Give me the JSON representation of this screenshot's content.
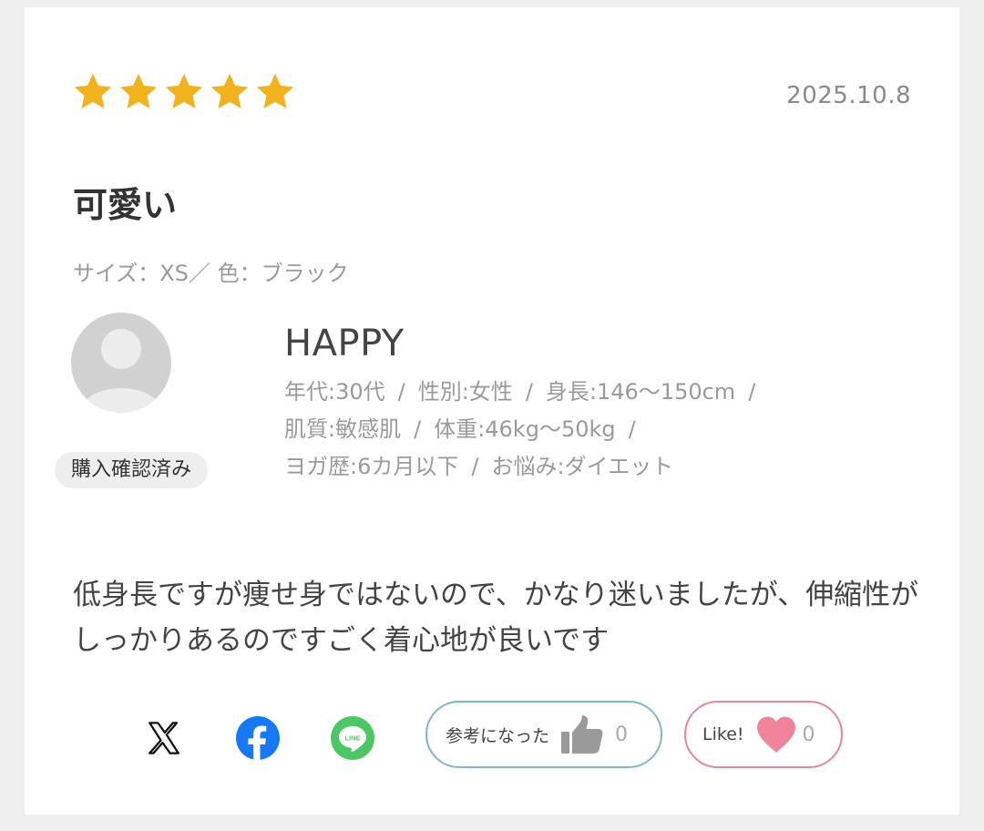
{
  "review": {
    "rating": 5,
    "max_rating": 5,
    "date": "2025.10.8",
    "title": "可愛い",
    "variant": "サイズ：XS／ 色：ブラック",
    "body": "低身長ですが痩せ身ではないので、かなり迷いましたが、伸縮性がしっかりあるのですごく着心地が良いです",
    "star_color": "#f2b21e"
  },
  "reviewer": {
    "name": "HAPPY",
    "badge": "購入確認済み",
    "attributes": [
      "年代:30代",
      "性別:女性",
      "身長:146〜150cm",
      "肌質:敏感肌",
      "体重:46kg〜50kg",
      "ヨガ歴:6カ月以下",
      "お悩み:ダイエット"
    ],
    "separator": "/"
  },
  "share": {
    "icons": [
      "x-icon",
      "facebook-icon",
      "line-icon"
    ],
    "line_label": "LINE",
    "facebook_color": "#1877f2",
    "line_color": "#4cc764"
  },
  "actions": {
    "helpful_label": "参考になった",
    "helpful_count": "0",
    "helpful_border": "#7fb9bd",
    "like_label": "Like!",
    "like_count": "0",
    "like_border": "#e08a98",
    "heart_color": "#f0849a"
  }
}
